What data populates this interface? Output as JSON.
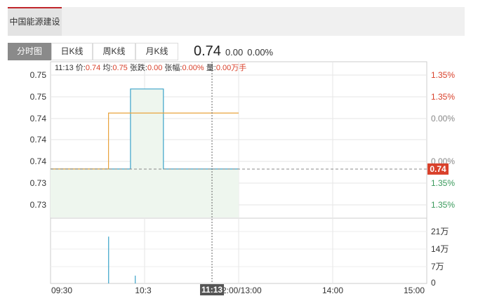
{
  "stock_tab": {
    "label": "中国能源建设"
  },
  "view_tabs": [
    {
      "label": "分时图",
      "active": true
    },
    {
      "label": "日K线",
      "active": false
    },
    {
      "label": "周K线",
      "active": false
    },
    {
      "label": "月K线",
      "active": false
    }
  ],
  "quote": {
    "price": "0.74",
    "change": "0.00",
    "change_pct": "0.00%"
  },
  "info": {
    "time": "11:13",
    "price_label": "价:",
    "price": "0.74",
    "avg_label": "均:",
    "avg": "0.75",
    "change_label": "张跌:",
    "change": "0.00",
    "change_pct_label": "张幅:",
    "change_pct": "0.00%",
    "volume_label": "量:",
    "volume": "0.00万手"
  },
  "chart_data": {
    "type": "line",
    "price_axis_labels": [
      "0.75",
      "0.75",
      "0.74",
      "0.74",
      "0.74",
      "0.73",
      "0.73"
    ],
    "pct_axis_labels": [
      "1.35%",
      "1.35%",
      "0.00%",
      "",
      "0.00%",
      "1.35%",
      "1.35%"
    ],
    "pct_axis_colors": [
      "#d9412b",
      "#d9412b",
      "#888888",
      "#888888",
      "#888888",
      "#3a9a5c",
      "#3a9a5c"
    ],
    "current_price_tag": "0.74",
    "volume_axis_labels": [
      "21万",
      "14万",
      "7万",
      "0"
    ],
    "x_tick_labels": [
      "09:30",
      "10:3",
      "12:00/13:00",
      "14:00",
      "15:00"
    ],
    "crosshair_time": "11:13",
    "price_series": {
      "x": [
        "09:30",
        "10:07",
        "10:07",
        "10:21",
        "10:21",
        "10:42",
        "10:42",
        "11:30"
      ],
      "y": [
        0.74,
        0.74,
        0.74,
        0.74,
        0.75,
        0.75,
        0.74,
        0.74
      ]
    },
    "avg_series": {
      "x": [
        "09:30",
        "10:07",
        "10:07",
        "11:30"
      ],
      "y": [
        0.74,
        0.74,
        0.747,
        0.747
      ]
    },
    "volume_series": {
      "x": [
        "10:07",
        "10:24"
      ],
      "y": [
        210000,
        35000
      ]
    },
    "colors": {
      "price": "#3aa3c9",
      "avg": "#e8a33c",
      "fill": "#eef6ee",
      "up": "#d9412b",
      "down": "#3a9a5c",
      "tag": "#d9412b"
    }
  }
}
